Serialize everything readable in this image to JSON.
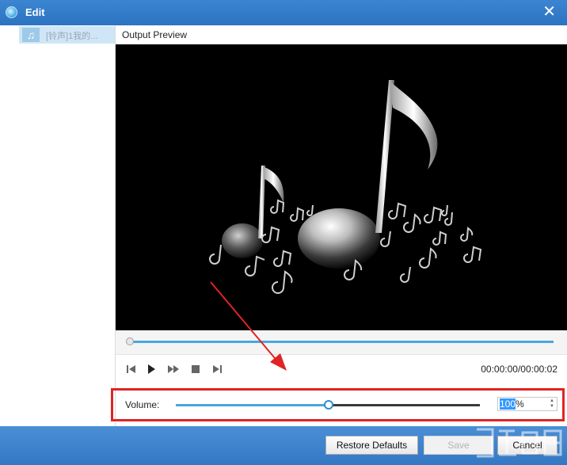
{
  "window": {
    "title": "Edit",
    "close_glyph": "✕"
  },
  "sidebar": {
    "items": [
      {
        "label": "[铃声]1我的...",
        "icon": "music-note-icon"
      }
    ]
  },
  "preview": {
    "header": "Output Preview"
  },
  "player": {
    "time": "00:00:00/00:00:02",
    "seek_progress": 0.0,
    "controls": [
      "skip-previous-icon",
      "play-icon",
      "fast-forward-icon",
      "stop-icon",
      "skip-next-icon"
    ]
  },
  "volume": {
    "label": "Volume:",
    "value_selected": "100",
    "value_unit": "%",
    "level": 0.5
  },
  "buttons": {
    "restore": "Restore Defaults",
    "save": "Save",
    "cancel": "Cancel"
  },
  "colors": {
    "title_bar": "#2c73c2",
    "accent": "#48a7dd",
    "highlight": "#e02424"
  }
}
